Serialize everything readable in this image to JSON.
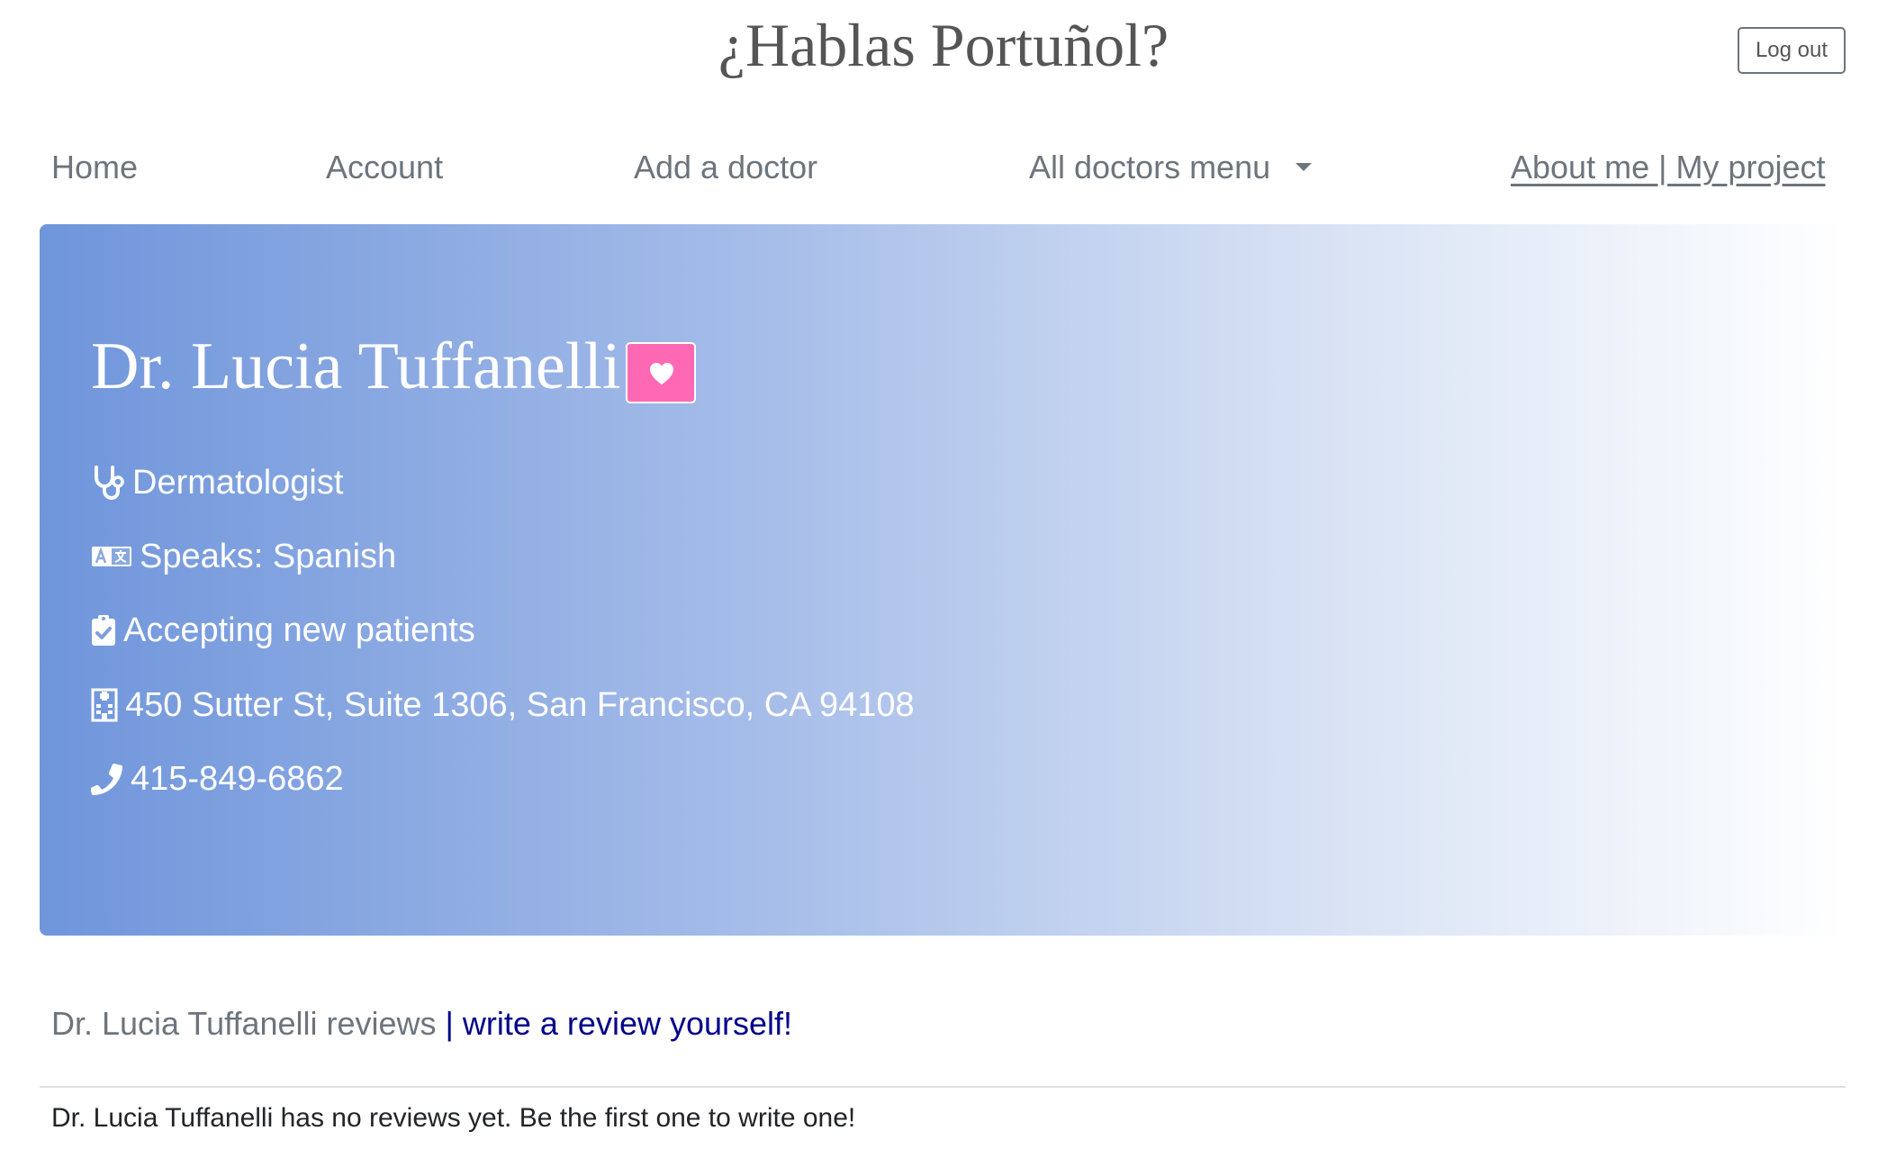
{
  "header": {
    "title": "¿Hablas Portuñol?",
    "logout_label": "Log out"
  },
  "nav": {
    "home": "Home",
    "account": "Account",
    "add_doctor": "Add a doctor",
    "all_doctors": "All doctors menu",
    "about": "About me | My project"
  },
  "doctor": {
    "name": "Dr. Lucia Tuffanelli",
    "specialty": "Dermatologist",
    "languages": "Speaks: Spanish",
    "status": "Accepting new patients",
    "address": "450 Sutter St, Suite 1306, San Francisco, CA 94108",
    "phone": "415-849-6862"
  },
  "reviews": {
    "heading": "Dr. Lucia Tuffanelli reviews",
    "write_link": " | write a review yourself!",
    "empty_message": "Dr. Lucia Tuffanelli has no reviews yet. Be the first one to write one!"
  },
  "icons": {
    "specialty": "stethoscope-icon",
    "languages": "language-icon",
    "status": "clipboard-check-icon",
    "address": "hospital-building-icon",
    "phone": "phone-icon",
    "favorite": "heart-icon"
  },
  "colors": {
    "jumbotron_start": "#6f95db",
    "jumbotron_end": "#ffffff",
    "favorite_button": "#ff69b4",
    "review_link": "#00008b",
    "muted_text": "#6c757d"
  }
}
